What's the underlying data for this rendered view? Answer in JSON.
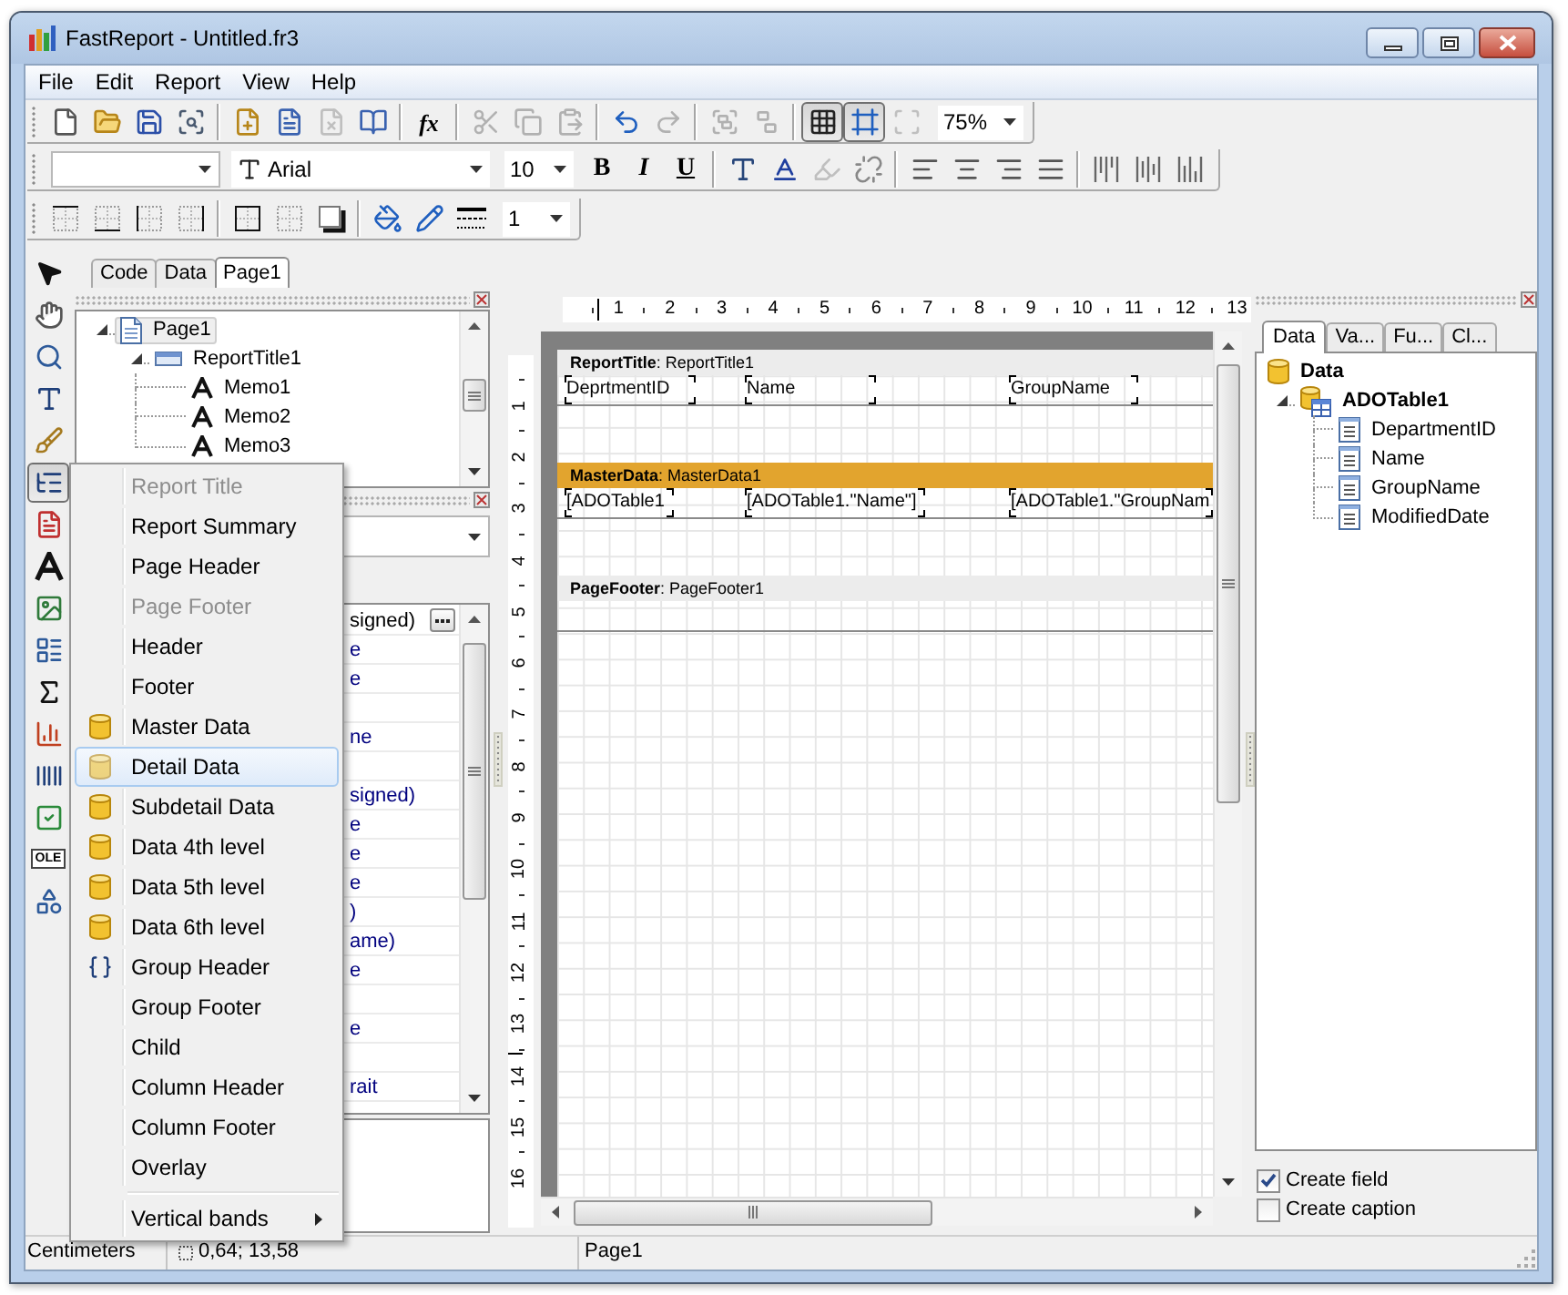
{
  "window": {
    "title": "FastReport - Untitled.fr3"
  },
  "menu_bar": [
    {
      "label": "File"
    },
    {
      "label": "Edit"
    },
    {
      "label": "Report"
    },
    {
      "label": "View"
    },
    {
      "label": "Help"
    }
  ],
  "toolbar_standard": [
    {
      "kind": "button",
      "disabled": false,
      "pressed": false
    },
    {
      "kind": "button",
      "disabled": false,
      "pressed": false
    },
    {
      "kind": "button",
      "disabled": false,
      "pressed": false
    },
    {
      "kind": "button",
      "disabled": false,
      "pressed": false
    },
    {
      "kind": "separator"
    },
    {
      "kind": "button",
      "disabled": false,
      "pressed": false
    },
    {
      "kind": "button",
      "disabled": false,
      "pressed": false
    },
    {
      "kind": "button",
      "disabled": true,
      "pressed": false
    },
    {
      "kind": "button",
      "disabled": false,
      "pressed": false
    },
    {
      "kind": "separator"
    },
    {
      "kind": "button",
      "label": "fx",
      "disabled": false,
      "pressed": false
    },
    {
      "kind": "separator"
    },
    {
      "kind": "button",
      "disabled": true,
      "pressed": false
    },
    {
      "kind": "button",
      "disabled": true,
      "pressed": false
    },
    {
      "kind": "button",
      "disabled": true,
      "pressed": false
    },
    {
      "kind": "separator"
    },
    {
      "kind": "button",
      "disabled": false,
      "pressed": false
    },
    {
      "kind": "button",
      "disabled": true,
      "pressed": false
    },
    {
      "kind": "separator"
    },
    {
      "kind": "button",
      "disabled": true,
      "pressed": false
    },
    {
      "kind": "button",
      "disabled": true,
      "pressed": false
    },
    {
      "kind": "separator"
    },
    {
      "kind": "button",
      "disabled": false,
      "pressed": true
    },
    {
      "kind": "button",
      "disabled": false,
      "pressed": true
    },
    {
      "kind": "button",
      "disabled": true,
      "pressed": false
    },
    {
      "kind": "combo",
      "value": "75%"
    }
  ],
  "toolbar_text": [
    {
      "kind": "combo"
    },
    {
      "kind": "combo",
      "value": "Arial"
    },
    {
      "kind": "combo",
      "value": "10"
    },
    {
      "kind": "button",
      "label": "B",
      "disabled": false
    },
    {
      "kind": "button",
      "label": "I",
      "disabled": false
    },
    {
      "kind": "button",
      "label": "U",
      "disabled": false
    },
    {
      "kind": "separator"
    },
    {
      "kind": "button",
      "disabled": false
    },
    {
      "kind": "button",
      "disabled": false
    },
    {
      "kind": "button",
      "disabled": true
    },
    {
      "kind": "button",
      "disabled": false
    },
    {
      "kind": "separator"
    },
    {
      "kind": "button",
      "disabled": false
    },
    {
      "kind": "button",
      "disabled": false
    },
    {
      "kind": "button",
      "disabled": false
    },
    {
      "kind": "button",
      "disabled": false
    },
    {
      "kind": "separator"
    },
    {
      "kind": "button",
      "disabled": false
    },
    {
      "kind": "button",
      "disabled": false
    },
    {
      "kind": "button",
      "disabled": false
    }
  ],
  "toolbar_frame": [
    {
      "kind": "button"
    },
    {
      "kind": "button"
    },
    {
      "kind": "button"
    },
    {
      "kind": "button"
    },
    {
      "kind": "separator"
    },
    {
      "kind": "button"
    },
    {
      "kind": "button"
    },
    {
      "kind": "button"
    },
    {
      "kind": "separator"
    },
    {
      "kind": "button"
    },
    {
      "kind": "button"
    },
    {
      "kind": "button"
    },
    {
      "kind": "combo",
      "value": "1"
    }
  ],
  "tools": [
    {
      "pressed": false
    },
    {
      "pressed": false
    },
    {
      "pressed": false
    },
    {
      "pressed": false
    },
    {
      "pressed": false
    },
    {
      "pressed": true
    },
    {
      "pressed": false
    },
    {
      "pressed": false
    },
    {
      "pressed": false
    },
    {
      "pressed": false
    },
    {
      "pressed": false
    },
    {
      "pressed": false
    },
    {
      "pressed": false
    },
    {
      "pressed": false
    },
    {
      "pressed": false,
      "label": "OLE"
    },
    {
      "pressed": false
    }
  ],
  "design_tabs": [
    {
      "label": "Code",
      "selected": false
    },
    {
      "label": "Data",
      "selected": false
    },
    {
      "label": "Page1",
      "selected": true
    }
  ],
  "object_tree": [
    {
      "kind": "page",
      "label": "Page1",
      "expanded": true,
      "selected": true,
      "children": [
        {
          "kind": "band",
          "label": "ReportTitle1",
          "expanded": true,
          "selected": false,
          "children": [
            {
              "kind": "memo",
              "label": "Memo1",
              "selected": false
            },
            {
              "kind": "memo",
              "label": "Memo2",
              "selected": false
            },
            {
              "kind": "memo",
              "label": "Memo3",
              "selected": false
            }
          ]
        }
      ]
    }
  ],
  "property_rows": [
    {
      "value": "signed)",
      "selected": true
    },
    {
      "value": "e",
      "selected": false
    },
    {
      "value": "e",
      "selected": false
    },
    {
      "selected": false
    },
    {
      "value": "ne",
      "selected": false
    },
    {
      "selected": false
    },
    {
      "value": "signed)",
      "selected": false
    },
    {
      "value": "e",
      "selected": false
    },
    {
      "value": "e",
      "selected": false
    },
    {
      "value": "e",
      "selected": false
    },
    {
      "value": ")",
      "selected": false
    },
    {
      "value": "ame)",
      "selected": false
    },
    {
      "value": "e",
      "selected": false
    },
    {
      "selected": false
    },
    {
      "value": "e",
      "selected": false
    },
    {
      "selected": false
    },
    {
      "value": "rait",
      "selected": false
    }
  ],
  "band_menu": [
    {
      "kind": "band",
      "label": "Report Title",
      "disabled": true,
      "selected": false
    },
    {
      "kind": "band",
      "label": "Report Summary",
      "disabled": false,
      "selected": false
    },
    {
      "kind": "band",
      "label": "Page Header",
      "disabled": false,
      "selected": false
    },
    {
      "kind": "band",
      "label": "Page Footer",
      "disabled": true,
      "selected": false
    },
    {
      "kind": "band",
      "label": "Header",
      "disabled": false,
      "selected": false
    },
    {
      "kind": "band",
      "label": "Footer",
      "disabled": false,
      "selected": false
    },
    {
      "kind": "data_band",
      "label": "Master Data",
      "disabled": false,
      "selected": false
    },
    {
      "kind": "data_band",
      "label": "Detail Data",
      "disabled": false,
      "selected": true
    },
    {
      "kind": "data_band",
      "label": "Subdetail Data",
      "disabled": false,
      "selected": false
    },
    {
      "kind": "data_band",
      "label": "Data 4th level",
      "disabled": false,
      "selected": false
    },
    {
      "kind": "data_band",
      "label": "Data 5th level",
      "disabled": false,
      "selected": false
    },
    {
      "kind": "data_band",
      "label": "Data 6th level",
      "disabled": false,
      "selected": false
    },
    {
      "kind": "group_band",
      "label": "Group Header",
      "disabled": false,
      "selected": false
    },
    {
      "kind": "band",
      "label": "Group Footer",
      "disabled": false,
      "selected": false
    },
    {
      "kind": "band",
      "label": "Child",
      "disabled": false,
      "selected": false
    },
    {
      "kind": "band",
      "label": "Column Header",
      "disabled": false,
      "selected": false
    },
    {
      "kind": "band",
      "label": "Column Footer",
      "disabled": false,
      "selected": false
    },
    {
      "kind": "band",
      "label": "Overlay",
      "disabled": false,
      "selected": false
    },
    {
      "kind": "separator"
    },
    {
      "kind": "submenu",
      "label": "Vertical bands",
      "disabled": false,
      "selected": false
    }
  ],
  "rulers": {
    "horizontal": [
      "1",
      "2",
      "3",
      "4",
      "5",
      "6",
      "7",
      "8",
      "9",
      "10",
      "11",
      "12",
      "13"
    ],
    "vertical": [
      "1",
      "2",
      "3",
      "4",
      "5",
      "6",
      "7",
      "8",
      "9",
      "10",
      "11",
      "12",
      "13",
      "14",
      "15",
      "16"
    ]
  },
  "report_page": {
    "bands": [
      {
        "header": "**ReportTitle**: ReportTitle1",
        "color": "#ececec",
        "memos": [
          {
            "text": "DeprtmentID"
          },
          {
            "text": "Name"
          },
          {
            "text": "GroupName"
          }
        ]
      },
      {
        "header": "**MasterData**: MasterData1",
        "color": "#e2a42e",
        "memos": [
          {
            "text": "[ADOTable1"
          },
          {
            "text": "[ADOTable1.\"Name\"]"
          },
          {
            "text": "[ADOTable1.\"GroupNam"
          }
        ]
      },
      {
        "header": "**PageFooter**: PageFooter1",
        "color": "#ececec"
      }
    ]
  },
  "data_tabs": [
    {
      "label": "Data",
      "selected": true
    },
    {
      "label": "Va...",
      "selected": false
    },
    {
      "label": "Fu...",
      "selected": false
    },
    {
      "label": "Cl...",
      "selected": false
    }
  ],
  "data_tree": [
    {
      "kind": "root",
      "label": "Data",
      "children": [
        {
          "kind": "table",
          "label": "ADOTable1",
          "expanded": true,
          "children": [
            {
              "kind": "field",
              "label": "DepartmentID"
            },
            {
              "kind": "field",
              "label": "Name"
            },
            {
              "kind": "field",
              "label": "GroupName"
            },
            {
              "kind": "field",
              "label": "ModifiedDate"
            }
          ]
        }
      ]
    }
  ],
  "data_options": [
    {
      "label": "Create field",
      "checked": true
    },
    {
      "label": "Create caption",
      "checked": false
    }
  ],
  "status_bar": {
    "units": "Centimeters",
    "position": "0,64; 13,58",
    "page": "Page1"
  }
}
